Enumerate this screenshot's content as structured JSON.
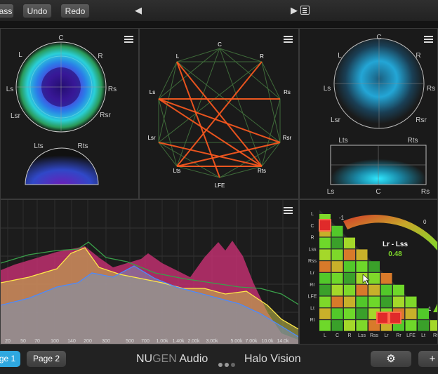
{
  "toolbar": {
    "bypass_label": "ass",
    "undo_label": "Undo",
    "redo_label": "Redo",
    "prev_icon": "◀",
    "play_icon": "▶"
  },
  "spatial_left": {
    "labels": [
      "C",
      "L",
      "R",
      "Ls",
      "Rs",
      "Lsr",
      "Rsr",
      "Lts",
      "Rts"
    ]
  },
  "correlation": {
    "labels": [
      "C",
      "L",
      "R",
      "Ls",
      "Rs",
      "Lsr",
      "Rsr",
      "Lts",
      "Rts",
      "LFE"
    ]
  },
  "spatial_right": {
    "labels": [
      "C",
      "L",
      "R",
      "Ls",
      "Rs",
      "Lsr",
      "Rsr",
      "Lts",
      "Rts"
    ],
    "lower_labels": [
      "Ls",
      "C",
      "Rs"
    ]
  },
  "spectrum": {
    "freq_labels": [
      "20",
      "50",
      "70",
      "100",
      "140",
      "200",
      "300",
      "500",
      "700",
      "1.00k",
      "1.40k",
      "2.00k",
      "3.00k",
      "5.00k",
      "7.00k",
      "10.0k",
      "14.0k"
    ]
  },
  "matrix": {
    "row_labels": [
      "L",
      "C",
      "R",
      "Lss",
      "Rss",
      "Lr",
      "Rr",
      "LFE",
      "Lt",
      "Rt"
    ],
    "col_labels": [
      "L",
      "C",
      "R",
      "Lss",
      "Rss",
      "Lr",
      "Rr",
      "LFE",
      "Lt",
      "Rt"
    ],
    "readout_name": "Lr - Lss",
    "readout_value": "0.48",
    "scale_min": "-1",
    "scale_mid": "0",
    "scale_max": "1"
  },
  "bottom": {
    "page1_label": "ge 1",
    "page2_label": "Page 2",
    "brand_nu": "NU",
    "brand_gen": "GEN",
    "brand_audio": " Audio",
    "product": "Halo Vision",
    "settings_icon": "gear-icon",
    "add_icon": "+"
  },
  "colors": {
    "accent_blue": "#2fa8e0",
    "correlation_line": "#ff5a1f",
    "magenta": "#d4317a"
  }
}
